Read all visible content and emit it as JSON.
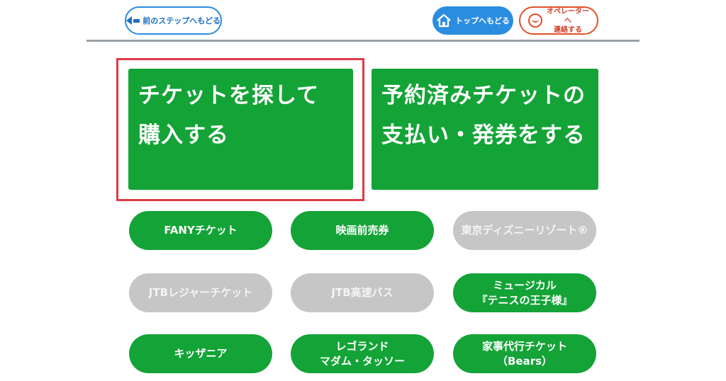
{
  "header": {
    "back_label": "前のステップへもどる",
    "top_label": "トップへもどる",
    "operator_line1": "オペレーターへ",
    "operator_line2": "連絡する"
  },
  "main": {
    "big_buttons": [
      {
        "line1": "チケットを探して",
        "line2": "購入する",
        "highlighted": true
      },
      {
        "line1": "予約済みチケットの",
        "line2": "支払い・発券をする",
        "highlighted": false
      }
    ],
    "colors": {
      "active": "#14a337",
      "disabled": "#c6c6c6",
      "highlight": "#e03a48",
      "accent_blue": "#2b8de0"
    },
    "small_buttons": [
      {
        "line1": "FANYチケット",
        "line2": "",
        "enabled": true
      },
      {
        "line1": "映画前売券",
        "line2": "",
        "enabled": true
      },
      {
        "line1": "東京ディズニーリゾート®",
        "line2": "",
        "enabled": false
      },
      {
        "line1": "JTBレジャーチケット",
        "line2": "",
        "enabled": false
      },
      {
        "line1": "JTB高速バス",
        "line2": "",
        "enabled": false
      },
      {
        "line1": "ミュージカル",
        "line2": "『テニスの王子様』",
        "enabled": true
      },
      {
        "line1": "キッザニア",
        "line2": "",
        "enabled": true
      },
      {
        "line1": "レゴランド",
        "line2": "マダム・タッソー",
        "enabled": true
      },
      {
        "line1": "家事代行チケット",
        "line2": "（Bears）",
        "enabled": true
      }
    ]
  }
}
